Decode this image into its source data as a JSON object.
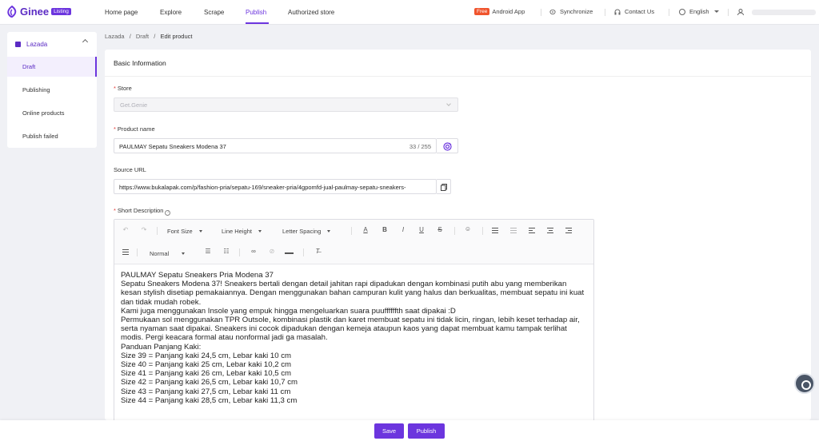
{
  "brand": {
    "name": "Ginee",
    "badge": "Listing",
    "color": "#6c35de"
  },
  "nav": {
    "items": [
      "Home page",
      "Explore",
      "Scrape",
      "Publish",
      "Authorized store"
    ],
    "active": "Publish"
  },
  "top_right": {
    "free_badge": "Free",
    "android": "Android App",
    "sync": "Synchronize",
    "contact": "Contact Us",
    "language": "English"
  },
  "sidebar": {
    "header": "Lazada",
    "items": [
      "Draft",
      "Publishing",
      "Online products",
      "Publish failed"
    ],
    "active": "Draft"
  },
  "breadcrumb": {
    "items": [
      "Lazada",
      "Draft",
      "Edit product"
    ],
    "separator": "/"
  },
  "form": {
    "section_title": "Basic Information",
    "store": {
      "label": "Store",
      "value": "Get.Genie"
    },
    "product_name": {
      "label": "Product name",
      "value": "PAULMAY Sepatu Sneakers Modena 37",
      "counter": "33 / 255"
    },
    "source_url": {
      "label": "Source URL",
      "value": "https://www.bukalapak.com/p/fashion-pria/sepatu-169/sneaker-pria/4gpomfd-jual-paulmay-sepatu-sneakers-"
    },
    "short_description": {
      "label": "Short Description",
      "help": "?"
    }
  },
  "editor": {
    "toolbar": {
      "font_size": "Font Size",
      "line_height": "Line Height",
      "letter_spacing": "Letter Spacing",
      "format": "Normal",
      "icons": [
        "undo-icon",
        "redo-icon",
        "font-color-icon",
        "bold-icon",
        "italic-icon",
        "underline-icon",
        "strikethrough-icon",
        "emoji-icon",
        "indent-icon",
        "outdent-icon",
        "align-left-icon",
        "align-center-icon",
        "align-right-icon",
        "align-justify-icon",
        "bullet-list-icon",
        "numbered-list-icon",
        "link-icon",
        "unlink-icon",
        "horizontal-rule-icon",
        "clear-format-icon"
      ]
    },
    "lines": [
      "PAULMAY Sepatu Sneakers Pria Modena 37",
      "Sepatu Sneakers Modena 37! Sneakers bertali dengan detail jahitan rapi dipadukan dengan kombinasi putih abu yang memberikan kesan stylish disetiap pemakaiannya. Dengan menggunakan bahan campuran kulit yang halus dan berkualitas, membuat sepatu ini kuat dan tidak mudah robek.",
      "Kami juga menggunakan Insole yang empuk hingga mengeluarkan suara puuffffffth saat dipakai :D",
      "Permukaan sol menggunakan TPR Outsole,  kombinasi plastik dan karet membuat sepatu ini tidak licin, ringan, lebih keset terhadap air, serta nyaman saat dipakai. Sneakers ini cocok dipadukan dengan kemeja ataupun kaos yang dapat membuat kamu tampak terlihat modis. Pergi keacara formal atau nonformal jadi ga masalah.",
      "Panduan Panjang Kaki:",
      "Size 39 = Panjang kaki 24,5 cm, Lebar kaki 10 cm",
      "Size 40 = Panjang kaki 25 cm, Lebar kaki 10,2 cm",
      "Size 41 = Panjang kaki 26 cm, Lebar kaki 10,5 cm",
      "Size 42 = Panjang kaki 26,5 cm, Lebar kaki 10,7 cm",
      "Size 43 = Panjang kaki 27,5 cm, Lebar kaki 11 cm",
      "Size 44 = Panjang kaki 28,5 cm, Lebar kaki 11,3 cm"
    ]
  },
  "footer": {
    "save": "Save",
    "publish": "Publish"
  }
}
